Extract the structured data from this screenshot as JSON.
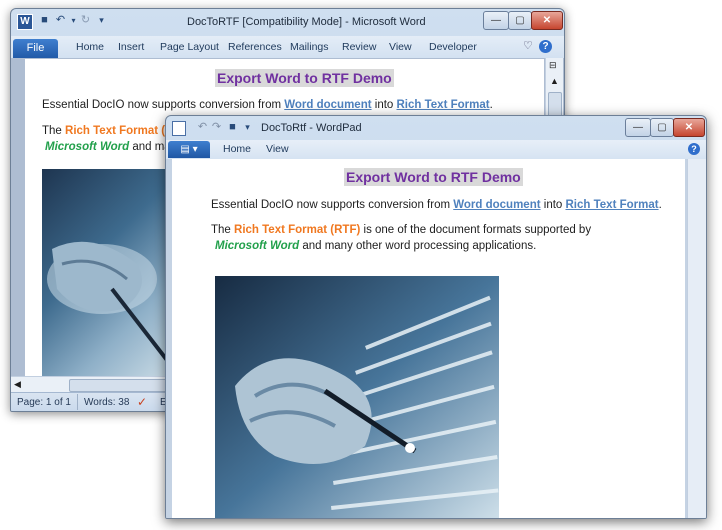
{
  "word": {
    "title": "DocToRTF [Compatibility Mode]  -  Microsoft Word",
    "app_icon_letter": "W",
    "ribbon_tabs": [
      "File",
      "Home",
      "Insert",
      "Page Layout",
      "References",
      "Mailings",
      "Review",
      "View",
      "Developer"
    ],
    "status": {
      "page": "Page: 1 of 1",
      "words": "Words: 38",
      "extra": "E"
    }
  },
  "wordpad": {
    "title": "DocToRtf - WordPad",
    "ribbon_tabs": [
      "Home",
      "View"
    ]
  },
  "document": {
    "heading": "Export Word to RTF Demo",
    "line1_pre": "Essential DocIO now supports conversion from ",
    "line1_link1": "Word document",
    "line1_mid": " into ",
    "line1_link2": "Rich Text Format",
    "line1_end": ".",
    "line2_pre": "The ",
    "line2_rtf": "Rich Text Format (RTF)",
    "line2_post": " is one of the document formats supported by",
    "line3_word": "Microsoft Word",
    "line3_post": " and many other word processing applications.",
    "word_line2_trunc": "Rich Text Format (RT",
    "word_line3_trunc": " and many"
  }
}
